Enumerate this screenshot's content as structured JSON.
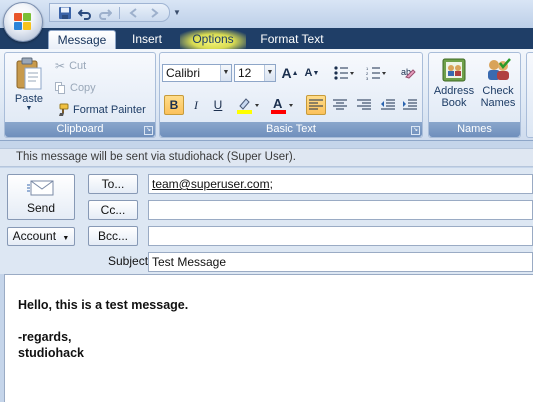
{
  "quick_access": {
    "buttons": [
      "save-icon",
      "undo-icon",
      "redo-icon",
      "previous-icon",
      "next-icon"
    ]
  },
  "tabs": [
    {
      "label": "Message",
      "state": "active"
    },
    {
      "label": "Insert",
      "state": "normal"
    },
    {
      "label": "Options",
      "state": "hover"
    },
    {
      "label": "Format Text",
      "state": "normal"
    }
  ],
  "ribbon": {
    "clipboard": {
      "label": "Clipboard",
      "paste": "Paste",
      "cut": "Cut",
      "copy": "Copy",
      "format_painter": "Format Painter"
    },
    "basic_text": {
      "label": "Basic Text",
      "font_name": "Calibri",
      "font_size": "12",
      "bold": "B",
      "italic": "I",
      "underline": "U",
      "highlight_color": "#ffff00",
      "font_color": "#ff0000"
    },
    "names": {
      "label": "Names",
      "address_book": "Address Book",
      "address_book_l1": "Address",
      "address_book_l2": "Book",
      "check_names_l1": "Check",
      "check_names_l2": "Names"
    }
  },
  "infobar": {
    "text": "This message will be sent via studiohack (Super User)."
  },
  "form": {
    "send": "Send",
    "account": "Account",
    "to_button": "To...",
    "cc_button": "Cc...",
    "bcc_button": "Bcc...",
    "to_value": "team@superuser.com",
    "to_suffix": ";",
    "cc_value": "",
    "bcc_value": "",
    "subject_label": "Subject:",
    "subject_value": "Test Message"
  },
  "message_body": {
    "lines": [
      "Hello, this is a test message.",
      "",
      "-regards,",
      "studiohack"
    ]
  },
  "colors": {
    "tab_bar": "#1f3e67",
    "ribbon_bg": "#dfe9f5",
    "active_format": "#fbc15b",
    "options_hover": "#d9dc52"
  }
}
